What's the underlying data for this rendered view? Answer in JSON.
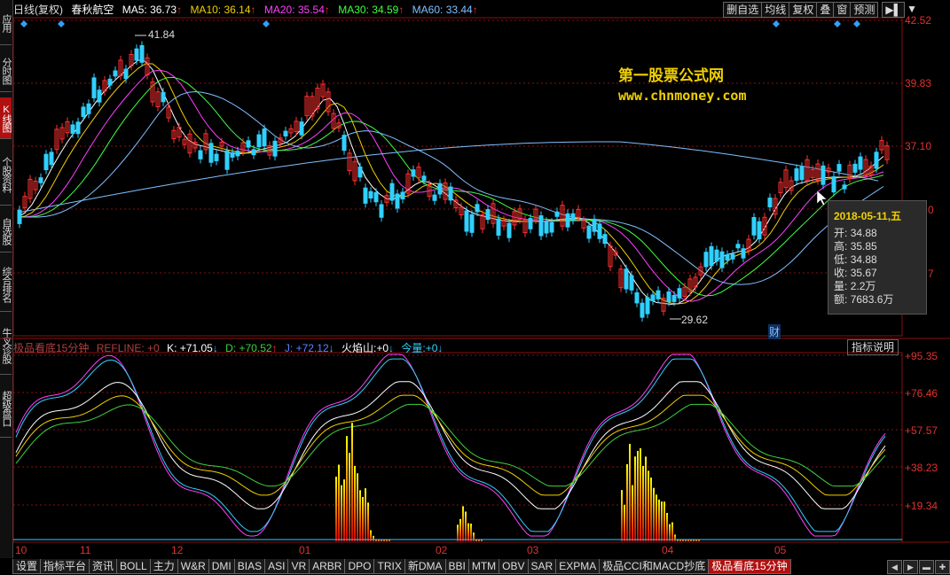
{
  "header": {
    "period": "日线(复权)",
    "stock_name": "春秋航空",
    "ma5": {
      "label": "MA5:",
      "value": "36.73",
      "color": "#ffffff"
    },
    "ma10": {
      "label": "MA10:",
      "value": "36.14",
      "color": "#f0d000"
    },
    "ma20": {
      "label": "MA20:",
      "value": "35.54",
      "color": "#ff40ff"
    },
    "ma30": {
      "label": "MA30:",
      "value": "34.59",
      "color": "#40ff40"
    },
    "ma60": {
      "label": "MA60:",
      "value": "33.44",
      "color": "#80c0ff"
    }
  },
  "toolbar": {
    "items": [
      "删自选",
      "均线",
      "复权",
      "叠",
      "窗",
      "预测"
    ],
    "arrow": "▶▌",
    "menu": "▼"
  },
  "left_tabs": [
    "应用",
    "分时图",
    "K线图",
    "个股资料",
    "自选股",
    "综合排名",
    "牛叉诊股",
    "超级盘口"
  ],
  "price_axis": [
    "42.52",
    "39.83",
    "37.10",
    "0",
    "7"
  ],
  "indicator_axis": [
    "+95.35",
    "+76.46",
    "+57.57",
    "+38.23",
    "+19.34"
  ],
  "watermark": {
    "line1": "第一股票公式网",
    "line2": "www.chnmoney.com"
  },
  "price_annotations": {
    "high": "41.84",
    "low": "29.62",
    "marker": "财"
  },
  "tooltip": {
    "date": "2018-05-11,五",
    "rows": [
      {
        "label": "开:",
        "value": "34.88"
      },
      {
        "label": "高:",
        "value": "35.85"
      },
      {
        "label": "低:",
        "value": "34.88"
      },
      {
        "label": "收:",
        "value": "35.67"
      },
      {
        "label": "量:",
        "value": "2.2万"
      },
      {
        "label": "额:",
        "value": "7683.6万"
      }
    ]
  },
  "indicator": {
    "name": "极品看底15分钟",
    "refline": "REFLINE: +0",
    "k": {
      "label": "K:",
      "value": "+71.05",
      "arrow": "↓"
    },
    "d": {
      "label": "D:",
      "value": "+70.52",
      "arrow": "↑"
    },
    "j": {
      "label": "J:",
      "value": "+72.12",
      "arrow": "↓"
    },
    "fire": {
      "label": "火焰山:",
      "value": "+0",
      "arrow": "↓"
    },
    "vol": {
      "label": "今量:",
      "value": "+0",
      "arrow": "↓"
    },
    "help_button": "指标说明"
  },
  "months": [
    "10",
    "11",
    "12",
    "01",
    "02",
    "03",
    "04",
    "05"
  ],
  "bottom_tabs": [
    "设置",
    "指标平台",
    "资讯",
    "BOLL",
    "主力",
    "W&R",
    "DMI",
    "BIAS",
    "ASI",
    "VR",
    "ARBR",
    "DPO",
    "TRIX",
    "新DMA",
    "BBI",
    "MTM",
    "OBV",
    "SAR",
    "EXPMA",
    "极品CCI和MACD抄底",
    "极品看底15分钟"
  ],
  "scroll_buttons": [
    "◀",
    "▶",
    "▬",
    "✚"
  ],
  "colors": {
    "up": "#ff3030",
    "down": "#30d0ff",
    "grid": "#8a1010",
    "accent": "#b01010"
  }
}
